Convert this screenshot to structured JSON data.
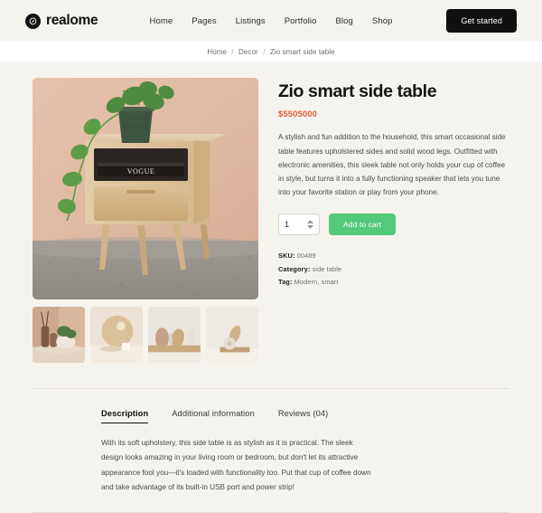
{
  "header": {
    "logo_text": "realome",
    "logo_icon": "compass-circle-icon",
    "nav": [
      {
        "label": "Home"
      },
      {
        "label": "Pages"
      },
      {
        "label": "Listings"
      },
      {
        "label": "Portfolio"
      },
      {
        "label": "Blog"
      },
      {
        "label": "Shop"
      }
    ],
    "cta_label": "Get started"
  },
  "breadcrumb": {
    "items": [
      "Home",
      "Decor",
      "Zio smart side table"
    ],
    "separator": "/"
  },
  "product": {
    "title": "Zio smart side table",
    "price": "$5505000",
    "description": "A stylish and fun addition to the household, this smart occasional side table features upholstered sides and solid wood legs. Outfitted with electronic amenities, this sleek table not only holds your cup of coffee in style, but turns it into a fully functioning speaker that lets you tune into your favorite station or play from your phone.",
    "quantity": "1",
    "add_to_cart_label": "Add to cart",
    "meta": [
      {
        "label": "SKU:",
        "value": "00489"
      },
      {
        "label": "Category:",
        "value": "side table"
      },
      {
        "label": "Tag:",
        "value": "Modern, smart"
      }
    ],
    "hero_alt": "wooden side table with pothos plant and Vogue magazine",
    "thumbnails": [
      {
        "alt": "vases and potted plant on round table"
      },
      {
        "alt": "round gold disc decor with candle"
      },
      {
        "alt": "ceramic vases on shelf"
      },
      {
        "alt": "sculptural decor object on wood base"
      }
    ]
  },
  "tabs": {
    "items": [
      {
        "label": "Description",
        "active": true
      },
      {
        "label": "Additional information",
        "active": false
      },
      {
        "label": "Reviews (04)",
        "active": false
      }
    ],
    "active_content": "With its soft upholstery, this side table is as stylish as it is practical. The sleek design looks amazing in your living room or bedroom, but don't let its attractive appearance fool you—it's loaded with functionality too. Put that cup of coffee down and take advantage of its built-in USB port and power strip!"
  },
  "colors": {
    "page_bg": "#f4f3ee",
    "accent_price": "#e2603f",
    "cart_green": "#54c97a",
    "cta_black": "#101010"
  }
}
